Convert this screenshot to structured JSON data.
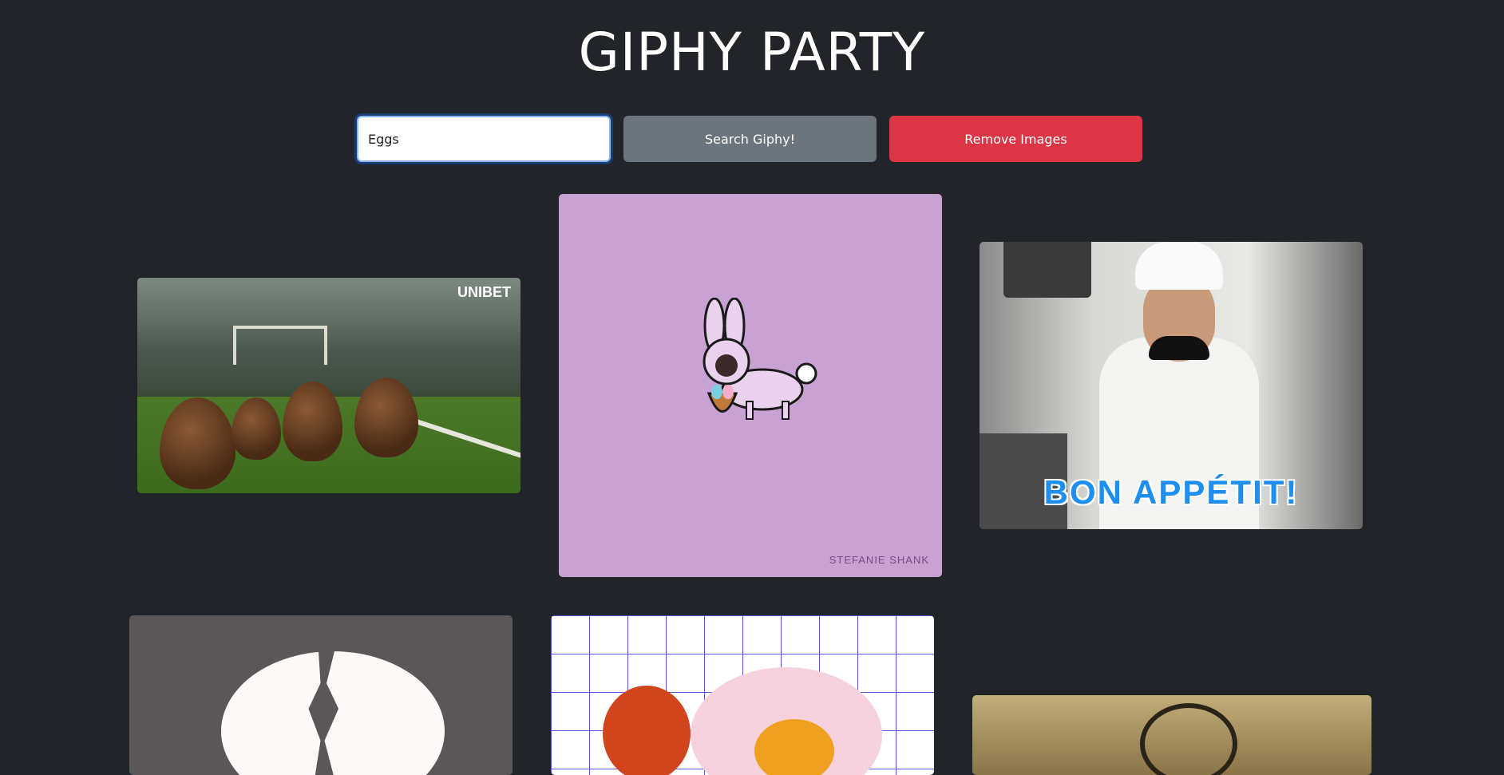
{
  "app": {
    "title": "GIPHY PARTY"
  },
  "search": {
    "value": "Eggs",
    "placeholder": ""
  },
  "buttons": {
    "search_label": "Search Giphy!",
    "remove_label": "Remove Images"
  },
  "colors": {
    "background": "#212429",
    "search_button": "#6c757d",
    "remove_button": "#dc3545"
  },
  "gifs": [
    {
      "subject": "chocolate eggs on grass",
      "overlay_text": "UNIBET"
    },
    {
      "subject": "bunny costume dog with basket",
      "overlay_text": "STEFANIE SHANK"
    },
    {
      "subject": "chef holding egg yolks",
      "overlay_text": "BON APPÉTIT!"
    },
    {
      "subject": "cracked egg",
      "overlay_text": ""
    },
    {
      "subject": "fried egg on grid",
      "overlay_text": ""
    },
    {
      "subject": "pan on stove",
      "overlay_text": ""
    }
  ]
}
